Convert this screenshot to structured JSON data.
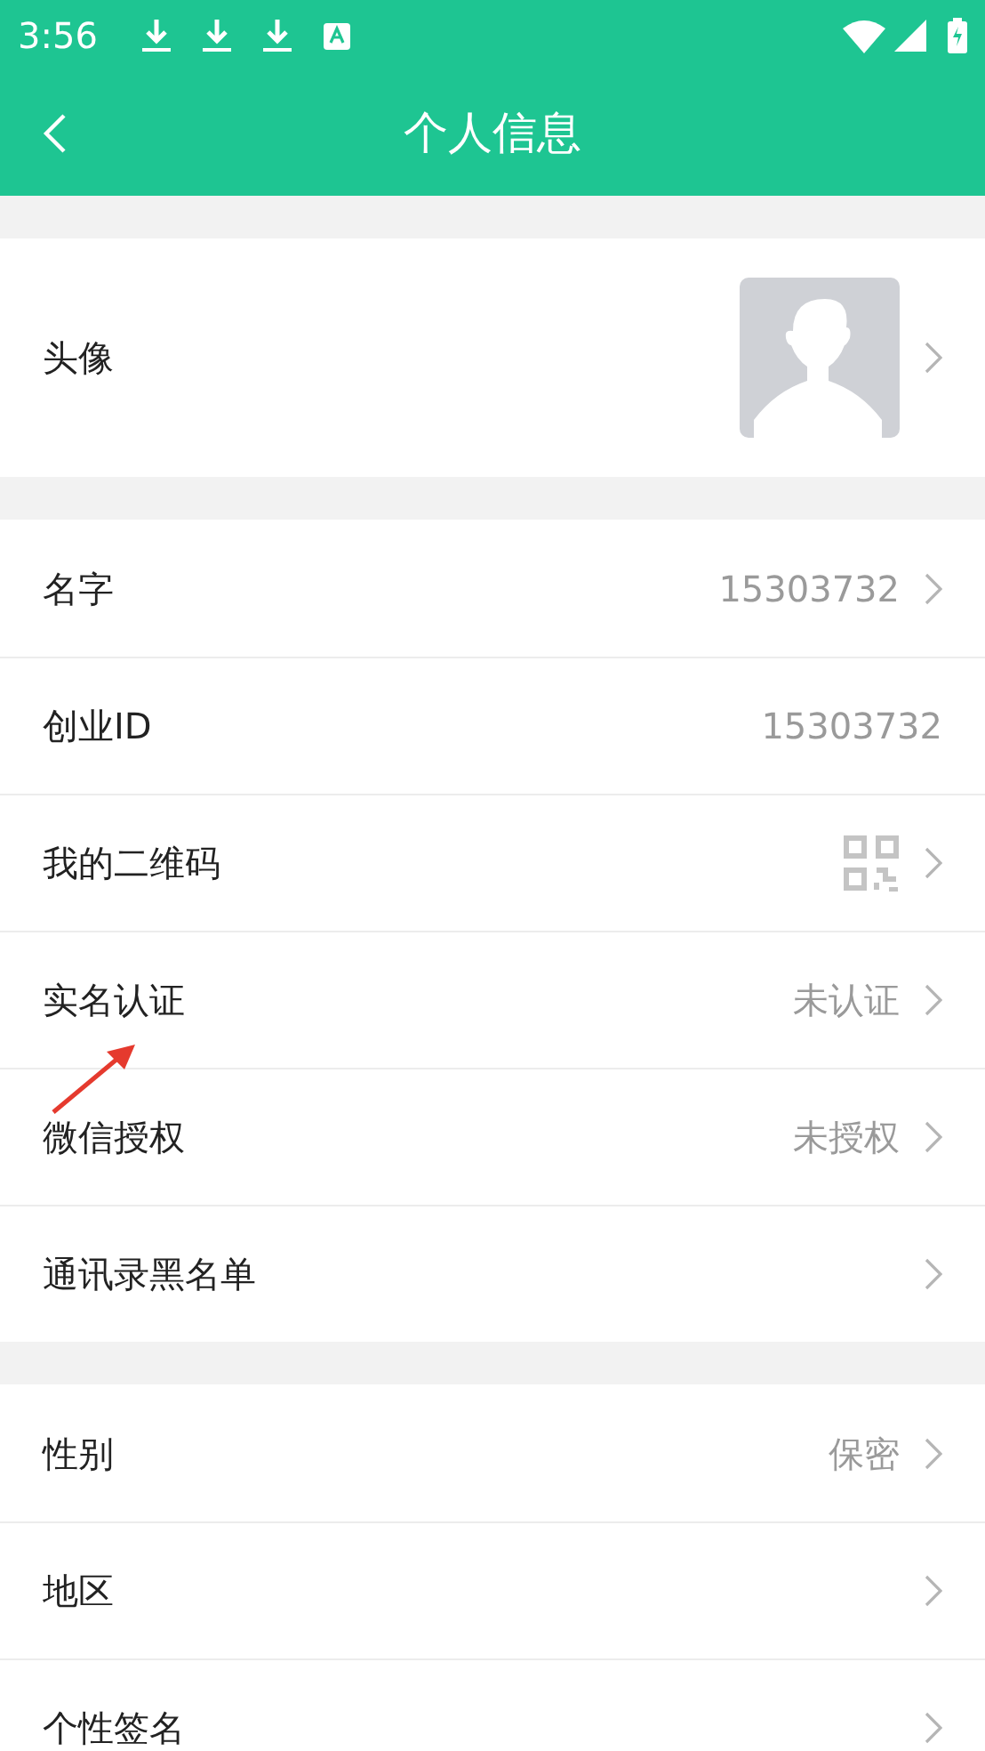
{
  "status_bar": {
    "time": "3:56"
  },
  "header": {
    "title": "个人信息"
  },
  "sections": [
    {
      "items": [
        {
          "kind": "avatar",
          "label": "头像",
          "chevron": true
        }
      ]
    },
    {
      "items": [
        {
          "kind": "text",
          "label": "名字",
          "value": "15303732",
          "chevron": true
        },
        {
          "kind": "text",
          "label": "创业ID",
          "value": "15303732",
          "chevron": false
        },
        {
          "kind": "qr",
          "label": "我的二维码",
          "chevron": true
        },
        {
          "kind": "text",
          "label": "实名认证",
          "value": "未认证",
          "chevron": true
        },
        {
          "kind": "text",
          "label": "微信授权",
          "value": "未授权",
          "chevron": true
        },
        {
          "kind": "text",
          "label": "通讯录黑名单",
          "chevron": true
        }
      ]
    },
    {
      "items": [
        {
          "kind": "text",
          "label": "性别",
          "value": "保密",
          "chevron": true
        },
        {
          "kind": "text",
          "label": "地区",
          "chevron": true
        },
        {
          "kind": "text",
          "label": "个性签名",
          "chevron": true
        }
      ]
    }
  ]
}
